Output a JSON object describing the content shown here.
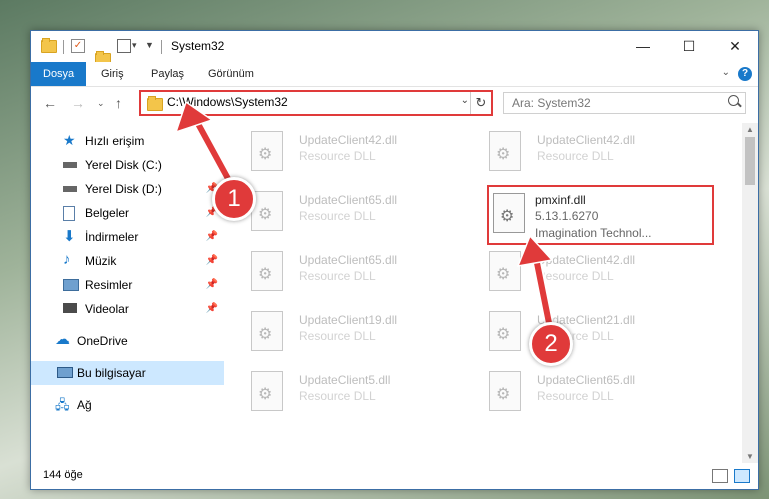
{
  "window": {
    "title": "System32",
    "minimize": "—",
    "maximize": "☐",
    "close": "✕"
  },
  "ribbon": {
    "tabs": [
      "Dosya",
      "Giriş",
      "Paylaş",
      "Görünüm"
    ],
    "help": "?"
  },
  "address": {
    "path": "C:\\Windows\\System32",
    "search_placeholder": "Ara: System32"
  },
  "sidebar": {
    "items": [
      {
        "label": "Hızlı erişim",
        "icon": "star-icon",
        "pinned": false
      },
      {
        "label": "Yerel Disk (C:)",
        "icon": "drive-icon",
        "pinned": false
      },
      {
        "label": "Yerel Disk (D:)",
        "icon": "drive-icon",
        "pinned": true
      },
      {
        "label": "Belgeler",
        "icon": "documents-icon",
        "pinned": true
      },
      {
        "label": "İndirmeler",
        "icon": "download-icon",
        "pinned": true
      },
      {
        "label": "Müzik",
        "icon": "music-icon",
        "pinned": true
      },
      {
        "label": "Resimler",
        "icon": "pictures-icon",
        "pinned": true
      },
      {
        "label": "Videolar",
        "icon": "videos-icon",
        "pinned": true
      },
      {
        "label": "OneDrive",
        "icon": "cloud-icon",
        "pinned": false
      },
      {
        "label": "Bu bilgisayar",
        "icon": "computer-icon",
        "pinned": false
      },
      {
        "label": "Ağ",
        "icon": "network-icon",
        "pinned": false
      }
    ]
  },
  "files": [
    {
      "name": "UpdateClient42.dll",
      "desc": "Resource DLL"
    },
    {
      "name": "UpdateClient42.dll",
      "desc": "Resource DLL"
    },
    {
      "name": "UpdateClient65.dll",
      "desc": "Resource DLL"
    },
    {
      "name": "pmxinf.dll",
      "desc": "5.13.1.6270",
      "desc2": "Imagination Technol..."
    },
    {
      "name": "UpdateClient65.dll",
      "desc": "Resource DLL"
    },
    {
      "name": "UpdateClient42.dll",
      "desc": "Resource DLL"
    },
    {
      "name": "UpdateClient19.dll",
      "desc": "Resource DLL"
    },
    {
      "name": "UpdateClient21.dll",
      "desc": "Resource DLL"
    },
    {
      "name": "UpdateClient5.dll",
      "desc": "Resource DLL"
    },
    {
      "name": "UpdateClient65.dll",
      "desc": "Resource DLL"
    }
  ],
  "status": {
    "count": "144 öğe"
  },
  "annotations": {
    "step1": "1",
    "step2": "2"
  },
  "colors": {
    "accent": "#1979ca",
    "highlight": "#e03a3a",
    "selected": "#cde8ff"
  }
}
